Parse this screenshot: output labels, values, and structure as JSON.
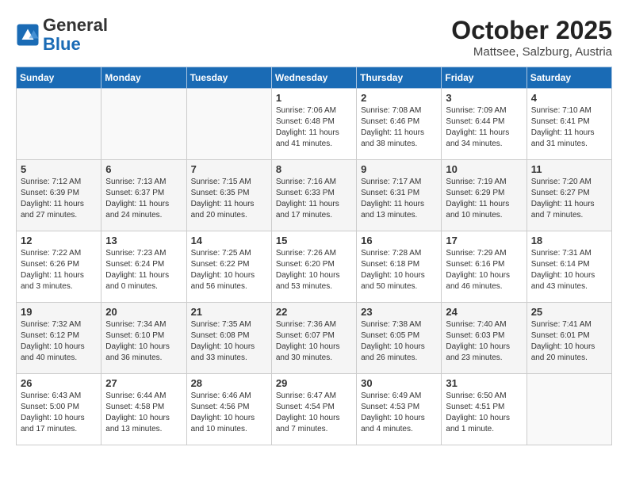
{
  "header": {
    "logo_line1": "General",
    "logo_line2": "Blue",
    "month": "October 2025",
    "location": "Mattsee, Salzburg, Austria"
  },
  "days_of_week": [
    "Sunday",
    "Monday",
    "Tuesday",
    "Wednesday",
    "Thursday",
    "Friday",
    "Saturday"
  ],
  "weeks": [
    [
      {
        "day": "",
        "content": ""
      },
      {
        "day": "",
        "content": ""
      },
      {
        "day": "",
        "content": ""
      },
      {
        "day": "1",
        "content": "Sunrise: 7:06 AM\nSunset: 6:48 PM\nDaylight: 11 hours\nand 41 minutes."
      },
      {
        "day": "2",
        "content": "Sunrise: 7:08 AM\nSunset: 6:46 PM\nDaylight: 11 hours\nand 38 minutes."
      },
      {
        "day": "3",
        "content": "Sunrise: 7:09 AM\nSunset: 6:44 PM\nDaylight: 11 hours\nand 34 minutes."
      },
      {
        "day": "4",
        "content": "Sunrise: 7:10 AM\nSunset: 6:41 PM\nDaylight: 11 hours\nand 31 minutes."
      }
    ],
    [
      {
        "day": "5",
        "content": "Sunrise: 7:12 AM\nSunset: 6:39 PM\nDaylight: 11 hours\nand 27 minutes."
      },
      {
        "day": "6",
        "content": "Sunrise: 7:13 AM\nSunset: 6:37 PM\nDaylight: 11 hours\nand 24 minutes."
      },
      {
        "day": "7",
        "content": "Sunrise: 7:15 AM\nSunset: 6:35 PM\nDaylight: 11 hours\nand 20 minutes."
      },
      {
        "day": "8",
        "content": "Sunrise: 7:16 AM\nSunset: 6:33 PM\nDaylight: 11 hours\nand 17 minutes."
      },
      {
        "day": "9",
        "content": "Sunrise: 7:17 AM\nSunset: 6:31 PM\nDaylight: 11 hours\nand 13 minutes."
      },
      {
        "day": "10",
        "content": "Sunrise: 7:19 AM\nSunset: 6:29 PM\nDaylight: 11 hours\nand 10 minutes."
      },
      {
        "day": "11",
        "content": "Sunrise: 7:20 AM\nSunset: 6:27 PM\nDaylight: 11 hours\nand 7 minutes."
      }
    ],
    [
      {
        "day": "12",
        "content": "Sunrise: 7:22 AM\nSunset: 6:26 PM\nDaylight: 11 hours\nand 3 minutes."
      },
      {
        "day": "13",
        "content": "Sunrise: 7:23 AM\nSunset: 6:24 PM\nDaylight: 11 hours\nand 0 minutes."
      },
      {
        "day": "14",
        "content": "Sunrise: 7:25 AM\nSunset: 6:22 PM\nDaylight: 10 hours\nand 56 minutes."
      },
      {
        "day": "15",
        "content": "Sunrise: 7:26 AM\nSunset: 6:20 PM\nDaylight: 10 hours\nand 53 minutes."
      },
      {
        "day": "16",
        "content": "Sunrise: 7:28 AM\nSunset: 6:18 PM\nDaylight: 10 hours\nand 50 minutes."
      },
      {
        "day": "17",
        "content": "Sunrise: 7:29 AM\nSunset: 6:16 PM\nDaylight: 10 hours\nand 46 minutes."
      },
      {
        "day": "18",
        "content": "Sunrise: 7:31 AM\nSunset: 6:14 PM\nDaylight: 10 hours\nand 43 minutes."
      }
    ],
    [
      {
        "day": "19",
        "content": "Sunrise: 7:32 AM\nSunset: 6:12 PM\nDaylight: 10 hours\nand 40 minutes."
      },
      {
        "day": "20",
        "content": "Sunrise: 7:34 AM\nSunset: 6:10 PM\nDaylight: 10 hours\nand 36 minutes."
      },
      {
        "day": "21",
        "content": "Sunrise: 7:35 AM\nSunset: 6:08 PM\nDaylight: 10 hours\nand 33 minutes."
      },
      {
        "day": "22",
        "content": "Sunrise: 7:36 AM\nSunset: 6:07 PM\nDaylight: 10 hours\nand 30 minutes."
      },
      {
        "day": "23",
        "content": "Sunrise: 7:38 AM\nSunset: 6:05 PM\nDaylight: 10 hours\nand 26 minutes."
      },
      {
        "day": "24",
        "content": "Sunrise: 7:40 AM\nSunset: 6:03 PM\nDaylight: 10 hours\nand 23 minutes."
      },
      {
        "day": "25",
        "content": "Sunrise: 7:41 AM\nSunset: 6:01 PM\nDaylight: 10 hours\nand 20 minutes."
      }
    ],
    [
      {
        "day": "26",
        "content": "Sunrise: 6:43 AM\nSunset: 5:00 PM\nDaylight: 10 hours\nand 17 minutes."
      },
      {
        "day": "27",
        "content": "Sunrise: 6:44 AM\nSunset: 4:58 PM\nDaylight: 10 hours\nand 13 minutes."
      },
      {
        "day": "28",
        "content": "Sunrise: 6:46 AM\nSunset: 4:56 PM\nDaylight: 10 hours\nand 10 minutes."
      },
      {
        "day": "29",
        "content": "Sunrise: 6:47 AM\nSunset: 4:54 PM\nDaylight: 10 hours\nand 7 minutes."
      },
      {
        "day": "30",
        "content": "Sunrise: 6:49 AM\nSunset: 4:53 PM\nDaylight: 10 hours\nand 4 minutes."
      },
      {
        "day": "31",
        "content": "Sunrise: 6:50 AM\nSunset: 4:51 PM\nDaylight: 10 hours\nand 1 minute."
      },
      {
        "day": "",
        "content": ""
      }
    ]
  ]
}
